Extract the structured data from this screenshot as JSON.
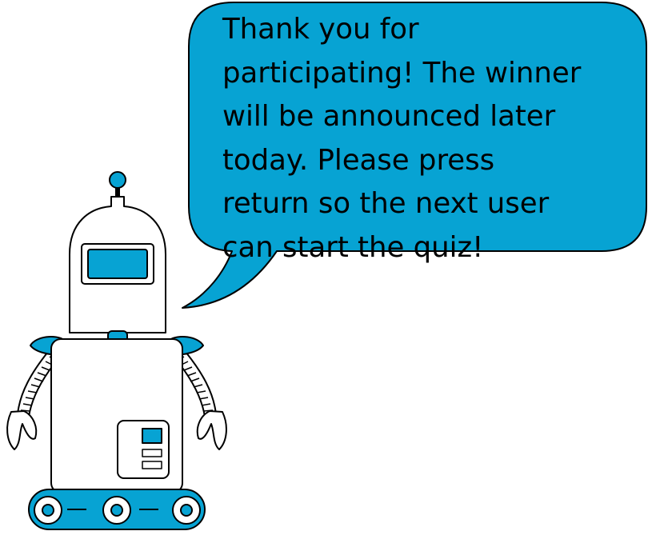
{
  "colors": {
    "accent": "#07a3d3",
    "outline": "#000000",
    "body": "#ffffff"
  },
  "speech_bubble": {
    "lines": [
      "Thank you for",
      "participating! The winner",
      "will be announced later",
      "today. Please press",
      "return so the next user",
      "can start the quiz!"
    ]
  },
  "robot": {
    "icon": "robot-illustration"
  }
}
